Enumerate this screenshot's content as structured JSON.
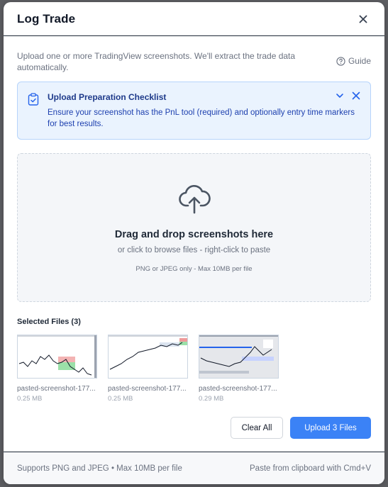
{
  "modal": {
    "title": "Log Trade",
    "intro": "Upload one or more TradingView screenshots. We'll extract the trade data automatically.",
    "guide_label": "Guide"
  },
  "checklist": {
    "title": "Upload Preparation Checklist",
    "text": "Ensure your screenshot has the PnL tool (required) and optionally entry time markers for best results."
  },
  "dropzone": {
    "title": "Drag and drop screenshots here",
    "subtitle": "or click to browse files - right-click to paste",
    "note": "PNG or JPEG only - Max 10MB per file"
  },
  "files": {
    "label": "Selected Files (3)",
    "items": [
      {
        "name": "pasted-screenshot-177...",
        "size": "0.25 MB"
      },
      {
        "name": "pasted-screenshot-177...",
        "size": "0.25 MB"
      },
      {
        "name": "pasted-screenshot-177...",
        "size": "0.29 MB"
      }
    ]
  },
  "actions": {
    "clear_label": "Clear All",
    "upload_label": "Upload 3 Files"
  },
  "footer": {
    "left": "Supports PNG and JPEG • Max 10MB per file",
    "right": "Paste from clipboard with Cmd+V"
  },
  "colors": {
    "accent": "#3b82f6",
    "checklist_bg": "#eaf3fe",
    "checklist_text": "#1e40af"
  },
  "icons": {
    "close": "close-icon",
    "guide": "help-circle-icon",
    "checklist": "clipboard-check-icon",
    "collapse": "chevron-down-icon",
    "dismiss": "close-icon",
    "upload": "cloud-upload-icon"
  }
}
